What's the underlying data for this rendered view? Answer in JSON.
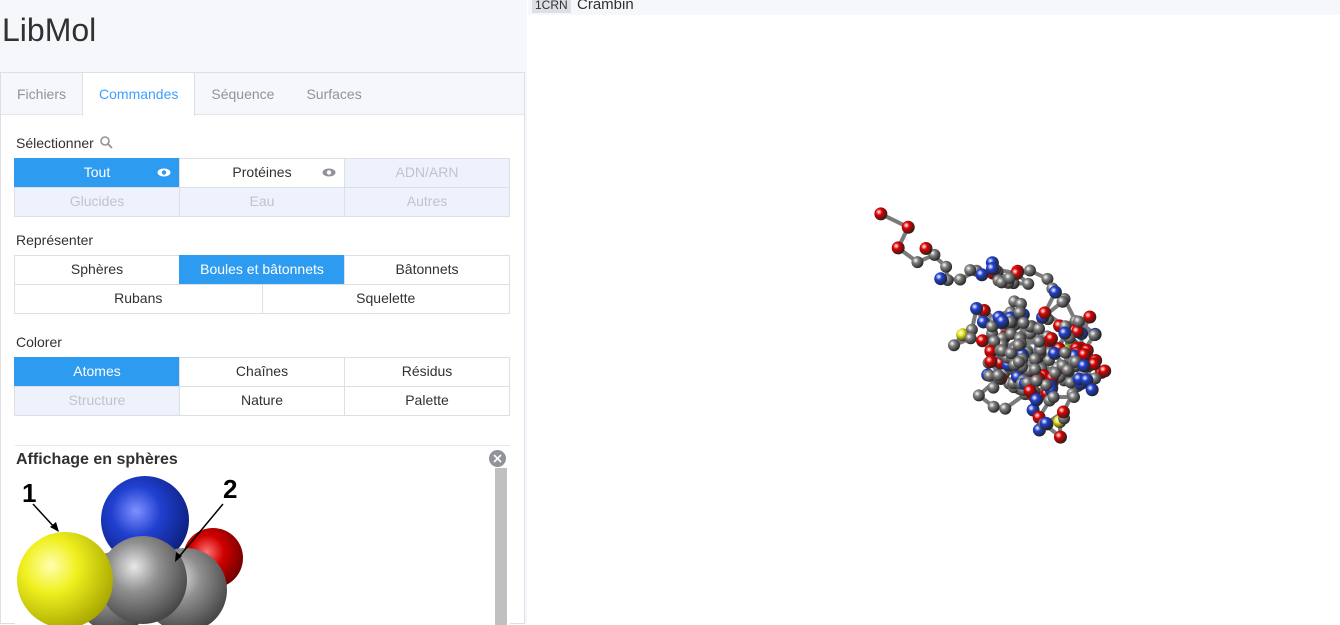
{
  "app": {
    "title": "LibMol"
  },
  "tabs": [
    {
      "label": "Fichiers"
    },
    {
      "label": "Commandes"
    },
    {
      "label": "Séquence"
    },
    {
      "label": "Surfaces"
    }
  ],
  "select_section": {
    "label": "Sélectionner",
    "row1": [
      {
        "label": "Tout",
        "state": "active",
        "icon": "eye-icon"
      },
      {
        "label": "Protéines",
        "state": "normal",
        "icon": "eye-icon"
      },
      {
        "label": "ADN/ARN",
        "state": "disabled"
      }
    ],
    "row2": [
      {
        "label": "Glucides",
        "state": "disabled"
      },
      {
        "label": "Eau",
        "state": "disabled"
      },
      {
        "label": "Autres",
        "state": "disabled"
      }
    ]
  },
  "represent_section": {
    "label": "Représenter",
    "row1": [
      {
        "label": "Sphères",
        "state": "normal"
      },
      {
        "label": "Boules et bâtonnets",
        "state": "active"
      },
      {
        "label": "Bâtonnets",
        "state": "normal"
      }
    ],
    "row2": [
      {
        "label": "Rubans",
        "state": "normal"
      },
      {
        "label": "Squelette",
        "state": "normal"
      }
    ]
  },
  "color_section": {
    "label": "Colorer",
    "row1": [
      {
        "label": "Atomes",
        "state": "active"
      },
      {
        "label": "Chaînes",
        "state": "normal"
      },
      {
        "label": "Résidus",
        "state": "normal"
      }
    ],
    "row2": [
      {
        "label": "Structure",
        "state": "disabled"
      },
      {
        "label": "Nature",
        "state": "normal"
      },
      {
        "label": "Palette",
        "state": "normal"
      }
    ]
  },
  "sphere_panel": {
    "title": "Affichage en sphères",
    "callout_1": "1",
    "callout_2": "2"
  },
  "viewer": {
    "pdb_id": "1CRN",
    "molecule_name": "Crambin"
  },
  "colors": {
    "accent": "#2d9bf0",
    "carbon": "#808080",
    "oxygen": "#e00000",
    "nitrogen": "#2040d0",
    "sulfur": "#e8e820"
  }
}
